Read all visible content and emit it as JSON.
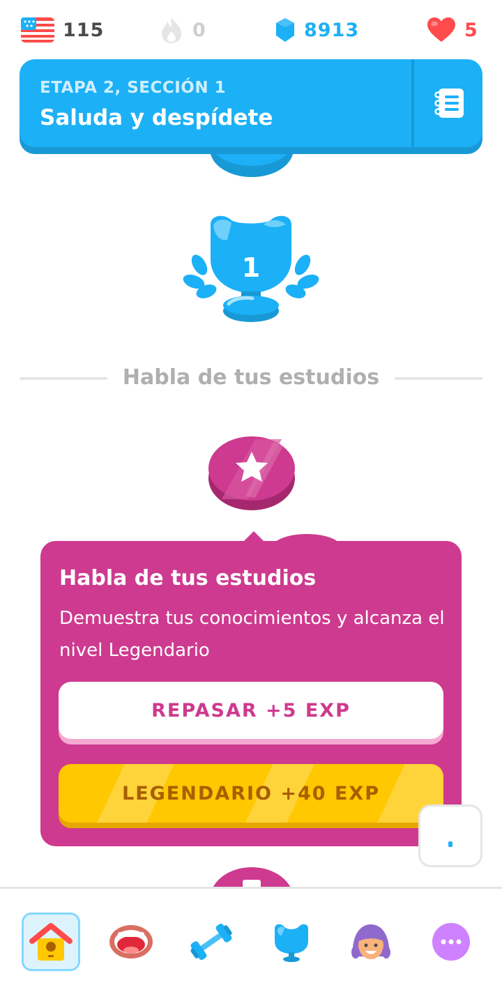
{
  "stats": {
    "course_flag": "us-flag-icon",
    "course_value": "115",
    "streak_value": "0",
    "gems_value": "8913",
    "hearts_value": "5"
  },
  "unit": {
    "subtitle": "ETAPA 2, SECCIÓN 1",
    "title": "Saluda y despídete",
    "guide_icon": "guidebook-icon",
    "color": "#1cb0f6"
  },
  "path": {
    "trophy_number": "1",
    "section_label": "Habla de tus estudios"
  },
  "popover": {
    "title": "Habla de tus estudios",
    "description": "Demuestra tus conocimientos y alcanza el nivel Legendario",
    "review_button": "REPASAR +5 EXP",
    "legendary_button": "LEGENDARIO +40 EXP",
    "color": "#ce3a8f",
    "legendary_color": "#ffc800"
  },
  "nav": {
    "items": [
      "home-icon",
      "speak-icon",
      "practice-icon",
      "leaderboard-icon",
      "profile-icon",
      "more-icon"
    ],
    "active": "home-icon"
  },
  "colors": {
    "blue": "#1cb0f6",
    "red": "#ff4b4b",
    "gray": "#afafaf"
  }
}
